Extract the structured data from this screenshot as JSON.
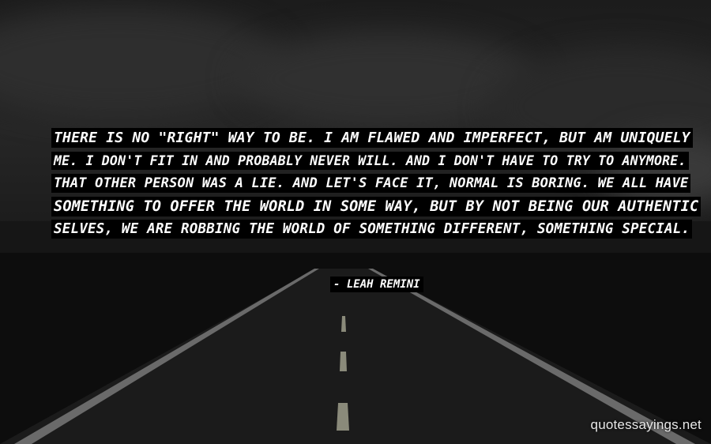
{
  "quote": {
    "lines": [
      "THERE IS NO \"RIGHT\" WAY TO BE. I AM FLAWED AND IMPERFECT, BUT AM UNIQUELY",
      "ME. I DON'T FIT IN AND PROBABLY NEVER WILL. AND I DON'T HAVE TO TRY TO ANYMORE.",
      "THAT OTHER PERSON WAS A LIE. AND LET'S FACE IT, NORMAL IS BORING. WE ALL HAVE",
      "SOMETHING TO OFFER THE WORLD IN SOME WAY, BUT BY NOT BEING OUR AUTHENTIC",
      "SELVES, WE ARE ROBBING THE WORLD OF SOMETHING DIFFERENT, SOMETHING SPECIAL."
    ],
    "author": "- LEAH REMINI"
  },
  "watermark": "quotessayings.net",
  "colors": {
    "text": "#ffffff",
    "highlight": "#000000",
    "sky": "#262626",
    "road": "#1b1b1b"
  }
}
